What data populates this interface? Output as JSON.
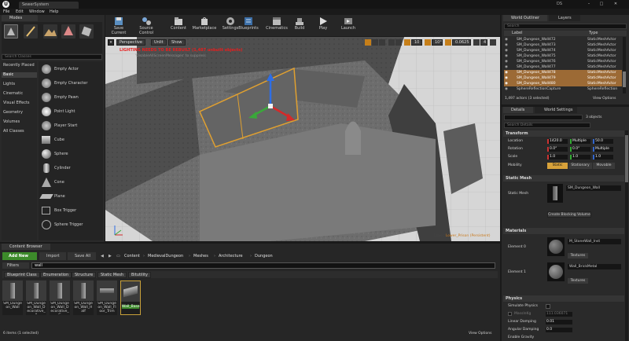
{
  "titlebar": {
    "app_letter": "U",
    "doc_tab": "SewerSystem",
    "user_badge": "DS"
  },
  "menu": [
    "File",
    "Edit",
    "Window",
    "Help"
  ],
  "modes": {
    "title": "Modes",
    "search_placeholder": "Search Classes"
  },
  "place_categories": [
    "Recently Placed",
    "Basic",
    "Lights",
    "Cinematic",
    "Visual Effects",
    "Geometry",
    "Volumes",
    "All Classes"
  ],
  "place_items": [
    "Empty Actor",
    "Empty Character",
    "Empty Pawn",
    "Point Light",
    "Player Start",
    "Cube",
    "Sphere",
    "Cylinder",
    "Cone",
    "Plane",
    "Box Trigger",
    "Sphere Trigger"
  ],
  "toolbar": [
    "Save Current",
    "Source Control",
    "Content",
    "Marketplace",
    "Settings",
    "Blueprints",
    "Cinematics",
    "Build",
    "Play",
    "Launch"
  ],
  "viewport": {
    "perspective": "Perspective",
    "lit": "Unlit",
    "show": "Show",
    "warning": "LIGHTING NEEDS TO BE REBUILT (1,487 unbuilt objects)",
    "warning_sub": "'DisableAllScreenMessages' to suppress",
    "grid_snap": "10",
    "rot_snap": "10°",
    "scale_snap": "0.0625",
    "cam_speed": "4",
    "level_label": "Level:",
    "level_name": "Lower_Prison (Persistent)"
  },
  "outliner": {
    "tab1": "World Outliner",
    "tab2": "Layers",
    "search_placeholder": "Search",
    "col_label": "Label",
    "col_type": "Type",
    "rows": [
      {
        "label": "SM_Dungeon_Wall472",
        "type": "StaticMeshActor",
        "sel": false
      },
      {
        "label": "SM_Dungeon_Wall473",
        "type": "StaticMeshActor",
        "sel": false
      },
      {
        "label": "SM_Dungeon_Wall474",
        "type": "StaticMeshActor",
        "sel": false
      },
      {
        "label": "SM_Dungeon_Wall475",
        "type": "StaticMeshActor",
        "sel": false
      },
      {
        "label": "SM_Dungeon_Wall476",
        "type": "StaticMeshActor",
        "sel": false
      },
      {
        "label": "SM_Dungeon_Wall477",
        "type": "StaticMeshActor",
        "sel": false
      },
      {
        "label": "SM_Dungeon_Wall478",
        "type": "StaticMeshActor",
        "sel": true
      },
      {
        "label": "SM_Dungeon_Wall479",
        "type": "StaticMeshActor",
        "sel": true
      },
      {
        "label": "SM_Dungeon_Wall480",
        "type": "StaticMeshActor",
        "sel": true
      },
      {
        "label": "SphereReflectionCapture",
        "type": "SphereReflection",
        "sel": false
      }
    ],
    "count": "1,497 actors (3 selected)",
    "view_options": "View Options"
  },
  "details": {
    "tab1": "Details",
    "tab2": "World Settings",
    "selected": "3 objects",
    "search_placeholder": "Search Details",
    "transform": "Transform",
    "location_label": "Location",
    "location": [
      "1420.0",
      "Multiple",
      "50.0"
    ],
    "rotation_label": "Rotation",
    "rotation": [
      "0.0°",
      "0.0°",
      "Multiple"
    ],
    "scale_label": "Scale",
    "scale": [
      "1.0",
      "1.0",
      "1.0"
    ],
    "mobility_label": "Mobility",
    "mobility": [
      "Static",
      "Stationary",
      "Movable"
    ],
    "static_mesh_section": "Static Mesh",
    "static_mesh_label": "Static Mesh",
    "static_mesh_value": "SM_Dungeon_Wall",
    "create_blocking": "Create Blocking Volume",
    "materials_section": "Materials",
    "element0": "Element 0",
    "element0_value": "M_StoneWall_Inst",
    "element1": "Element 1",
    "element1_value": "Wall_BrickMetal",
    "textures": "Textures",
    "physics_section": "Physics",
    "simulate_physics": "Simulate Physics",
    "mass": "MassInKg",
    "mass_value": "111.036071",
    "linear_damping": "Linear Damping",
    "linear_damping_value": "0.01",
    "angular_damping": "Angular Damping",
    "angular_damping_value": "0.0",
    "enable_gravity": "Enable Gravity"
  },
  "content_browser": {
    "title": "Content Browser",
    "add_new": "Add New",
    "import": "Import",
    "save_all": "Save All",
    "breadcrumb": [
      "Content",
      "MedievalDungeon",
      "Meshes",
      "Architecture",
      "Dungeon"
    ],
    "filters": "Filters",
    "search_value": "wall",
    "filter_chips": [
      "Blueprint Class",
      "Enumeration",
      "Structure",
      "Static Mesh",
      "Bitutility"
    ],
    "assets": [
      "SM_Dungeon_Wall",
      "SM_Dungeon_Wall_Decorative_A",
      "SM_Dungeon_Wall_Decorative_G",
      "SM_Dungeon_Wall_Half",
      "SM_Dungeon_Wall_Floor_Trim",
      "Wall_Base"
    ],
    "status": "6 items (1 selected)",
    "view_options": "View Options"
  }
}
